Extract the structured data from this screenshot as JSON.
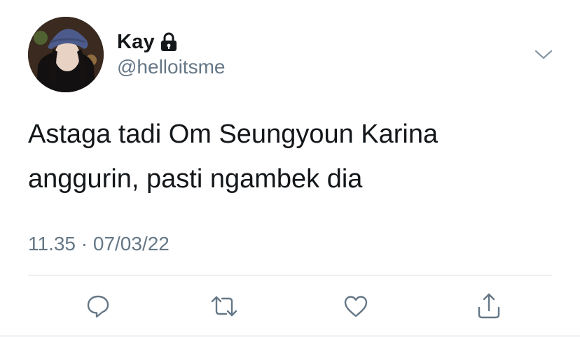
{
  "tweet": {
    "author": {
      "display_name": "Kay",
      "handle": "@helloitsme",
      "protected_icon": "lock-icon",
      "avatar": "profile-photo"
    },
    "text_lines": [
      "Astaga tadi Om Seungyoun Karina",
      "anggurin, pasti ngambek dia"
    ],
    "timestamp": "11.35 · 07/03/22",
    "menu_icon": "chevron-down-icon",
    "actions": [
      {
        "name": "reply",
        "icon": "speech-bubble-icon"
      },
      {
        "name": "retweet",
        "icon": "retweet-arrows-icon"
      },
      {
        "name": "like",
        "icon": "heart-icon"
      },
      {
        "name": "share",
        "icon": "share-upload-icon"
      }
    ]
  },
  "colors": {
    "text_primary": "#14171a",
    "text_secondary": "#657786",
    "divider": "#d6dbdf",
    "background": "#ffffff"
  }
}
